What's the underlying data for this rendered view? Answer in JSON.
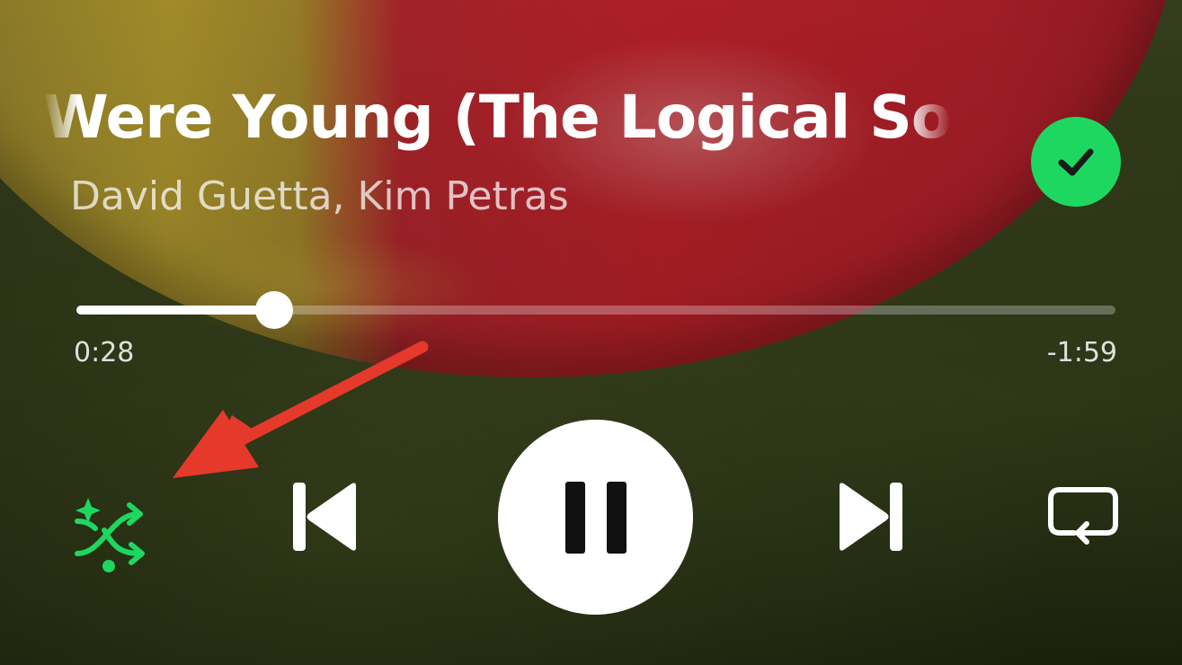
{
  "track": {
    "title": "Were Young (The Logical Son",
    "artist": "David Guetta, Kim Petras",
    "liked": true
  },
  "progress": {
    "elapsed": "0:28",
    "remaining": "-1:59",
    "fraction": 0.19
  },
  "controls": {
    "shuffle_icon": "smart-shuffle-icon",
    "shuffle_active": true,
    "previous_icon": "skip-previous-icon",
    "play_pause_icon": "pause-icon",
    "next_icon": "skip-next-icon",
    "repeat_icon": "repeat-icon"
  },
  "colors": {
    "accent": "#1ed760",
    "annotation_arrow": "#e5392b"
  }
}
